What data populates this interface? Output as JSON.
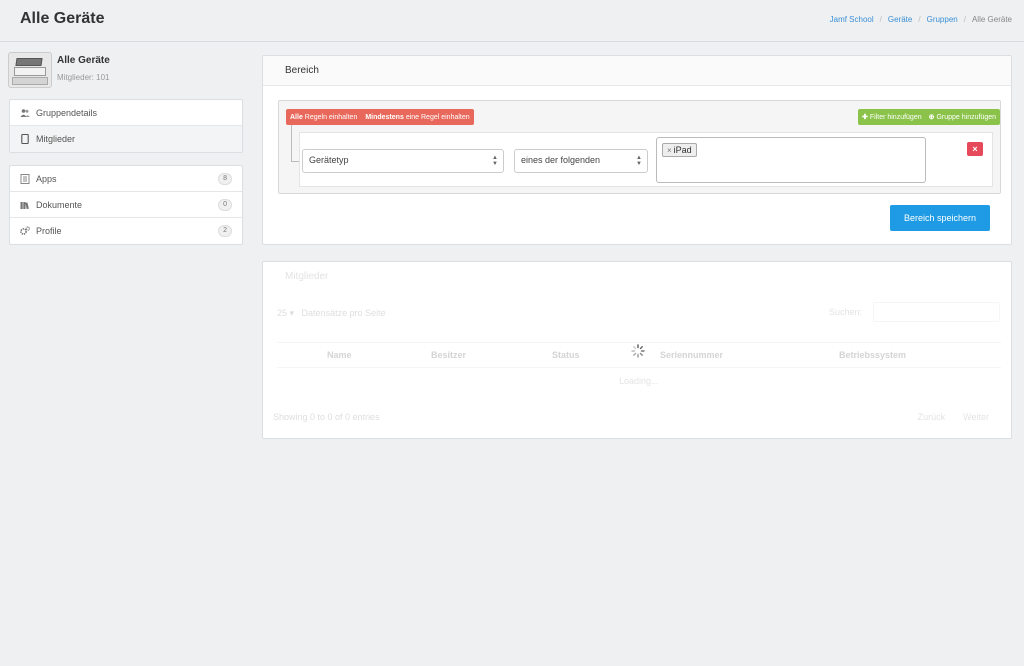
{
  "header": {
    "title": "Alle Geräte",
    "breadcrumb": [
      "Jamf School",
      "Geräte",
      "Gruppen",
      "Alle Geräte"
    ]
  },
  "group": {
    "name": "Alle Geräte",
    "members": "Mitglieder: 101"
  },
  "sidebar": {
    "menu1": [
      {
        "label": "Gruppendetails",
        "icon": "users-icon"
      },
      {
        "label": "Mitglieder",
        "icon": "tablet-icon"
      }
    ],
    "menu2": [
      {
        "label": "Apps",
        "icon": "apps-icon",
        "count": "8"
      },
      {
        "label": "Dokumente",
        "icon": "books-icon",
        "count": "0"
      },
      {
        "label": "Profile",
        "icon": "gears-icon",
        "count": "2"
      }
    ]
  },
  "bereich": {
    "title": "Bereich",
    "cond_all_bold": "Alle",
    "cond_all_text": "Regeln einhalten",
    "cond_any_bold": "Mindestens",
    "cond_any_text": "eine Regel einhalten",
    "add_filter": "Filter hinzufügen",
    "add_group": "Gruppe hinzufügen",
    "field_select": "Gerätetyp",
    "operator_select": "eines der folgenden",
    "tag_value": "iPad",
    "tag_remove": "×",
    "remove_rule": "×",
    "save_button": "Bereich speichern"
  },
  "members_panel": {
    "title": "Mitglieder",
    "length_value": "25",
    "length_label": "Datensätze pro Seite",
    "search_label": "Suchen:",
    "columns": [
      "Name",
      "Besitzer",
      "Status",
      "Seriennummer",
      "Betriebssystem"
    ],
    "loading": "Loading...",
    "info": "Showing 0 to 0 of 0 entries",
    "prev": "Zurück",
    "next": "Weiter"
  },
  "colors": {
    "accent": "#1e9be4",
    "condition": "#e8695c",
    "add": "#8bc34a",
    "remove": "#e64a5a"
  }
}
